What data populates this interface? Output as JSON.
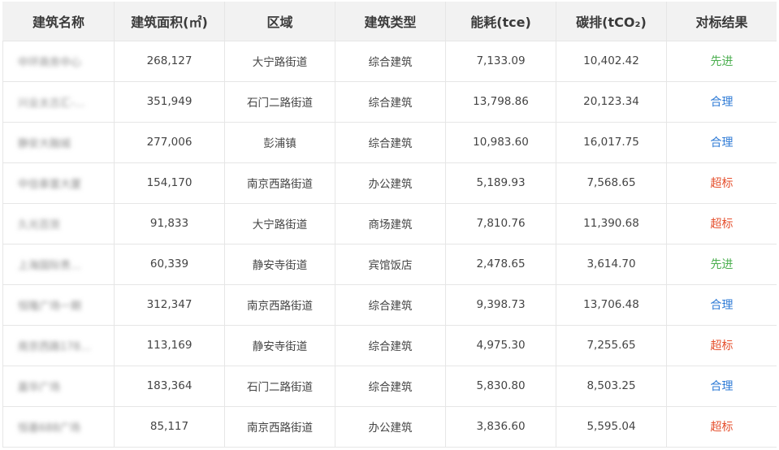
{
  "table": {
    "headers": [
      "建筑名称",
      "建筑面积(㎡)",
      "区域",
      "建筑类型",
      "能耗(tce)",
      "碳排(tCO₂)",
      "对标结果"
    ],
    "result_colors": {
      "先进": "#4caf50",
      "合理": "#2f7bd6",
      "超标": "#e5502e"
    },
    "rows": [
      {
        "name": "中环商务中心",
        "area": "268,127",
        "district": "大宁路街道",
        "type": "综合建筑",
        "energy": "7,133.09",
        "carbon": "10,402.42",
        "result": "先进"
      },
      {
        "name": "兴业太古汇-…",
        "area": "351,949",
        "district": "石门二路街道",
        "type": "综合建筑",
        "energy": "13,798.86",
        "carbon": "20,123.34",
        "result": "合理"
      },
      {
        "name": "静安大融城",
        "area": "277,006",
        "district": "彭浦镇",
        "type": "综合建筑",
        "energy": "10,983.60",
        "carbon": "16,017.75",
        "result": "合理"
      },
      {
        "name": "中信泰富大厦",
        "area": "154,170",
        "district": "南京西路街道",
        "type": "办公建筑",
        "energy": "5,189.93",
        "carbon": "7,568.65",
        "result": "超标"
      },
      {
        "name": "久光百货",
        "area": "91,833",
        "district": "大宁路街道",
        "type": "商场建筑",
        "energy": "7,810.76",
        "carbon": "11,390.68",
        "result": "超标"
      },
      {
        "name": "上海国际贵…",
        "area": "60,339",
        "district": "静安寺街道",
        "type": "宾馆饭店",
        "energy": "2,478.65",
        "carbon": "3,614.70",
        "result": "先进"
      },
      {
        "name": "恒隆广场一期",
        "area": "312,347",
        "district": "南京西路街道",
        "type": "综合建筑",
        "energy": "9,398.73",
        "carbon": "13,706.48",
        "result": "合理"
      },
      {
        "name": "南京西路178…",
        "area": "113,169",
        "district": "静安寺街道",
        "type": "综合建筑",
        "energy": "4,975.30",
        "carbon": "7,255.65",
        "result": "超标"
      },
      {
        "name": "嘉华广场",
        "area": "183,364",
        "district": "石门二路街道",
        "type": "综合建筑",
        "energy": "5,830.80",
        "carbon": "8,503.25",
        "result": "合理"
      },
      {
        "name": "恒基688广场",
        "area": "85,117",
        "district": "南京西路街道",
        "type": "办公建筑",
        "energy": "3,836.60",
        "carbon": "5,595.04",
        "result": "超标"
      }
    ]
  }
}
